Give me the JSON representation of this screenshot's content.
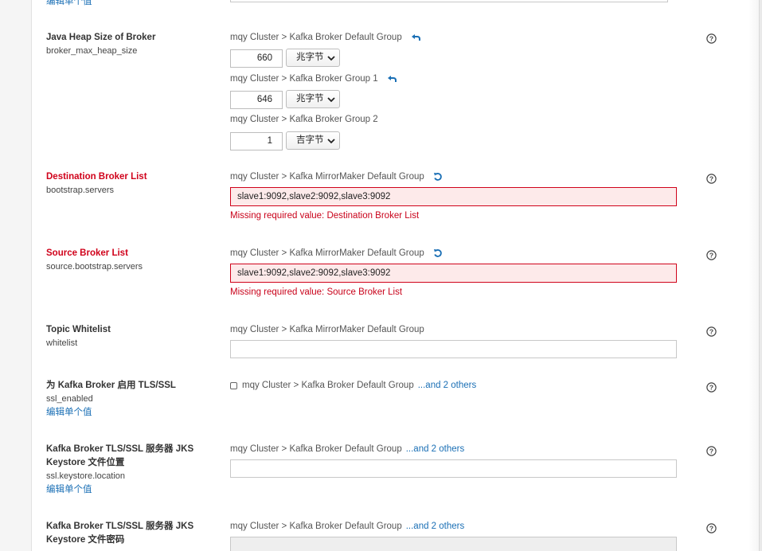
{
  "top_link": "编辑单个值",
  "properties": {
    "heap": {
      "title": "Java Heap Size of Broker",
      "key": "broker_max_heap_size",
      "groups": [
        {
          "label": "mqy Cluster > Kafka Broker Default Group",
          "value": "660",
          "unit": "兆字节"
        },
        {
          "label": "mqy Cluster > Kafka Broker Group 1",
          "value": "646",
          "unit": "兆字节"
        },
        {
          "label": "mqy Cluster > Kafka Broker Group 2",
          "value": "1",
          "unit": "吉字节"
        }
      ]
    },
    "dest": {
      "title": "Destination Broker List",
      "key": "bootstrap.servers",
      "group": "mqy Cluster > Kafka MirrorMaker Default Group",
      "value": "slave1:9092,slave2:9092,slave3:9092",
      "error": "Missing required value: Destination Broker List"
    },
    "source": {
      "title": "Source Broker List",
      "key": "source.bootstrap.servers",
      "group": "mqy Cluster > Kafka MirrorMaker Default Group",
      "value": "slave1:9092,slave2:9092,slave3:9092",
      "error": "Missing required value: Source Broker List"
    },
    "whitelist": {
      "title": "Topic Whitelist",
      "key": "whitelist",
      "group": "mqy Cluster > Kafka MirrorMaker Default Group",
      "value": ""
    },
    "ssl": {
      "title": "为 Kafka Broker 启用 TLS/SSL",
      "key": "ssl_enabled",
      "edit": "编辑单个值",
      "group": "mqy Cluster > Kafka Broker Default Group",
      "others": "...and 2 others"
    },
    "keystore": {
      "title_line1": "Kafka Broker TLS/SSL 服务器 JKS",
      "title_line2": "Keystore 文件位置",
      "key": "ssl.keystore.location",
      "edit": "编辑单个值",
      "group": "mqy Cluster > Kafka Broker Default Group",
      "others": "...and 2 others",
      "value": ""
    },
    "keystore_pw": {
      "title_line1": "Kafka Broker TLS/SSL 服务器 JKS",
      "title_line2": "Keystore 文件密码",
      "group": "mqy Cluster > Kafka Broker Default Group",
      "others": "...and 2 others"
    }
  },
  "colors": {
    "error": "#d0021b",
    "link": "#1a6fb5",
    "error_bg": "#fdeaea"
  }
}
